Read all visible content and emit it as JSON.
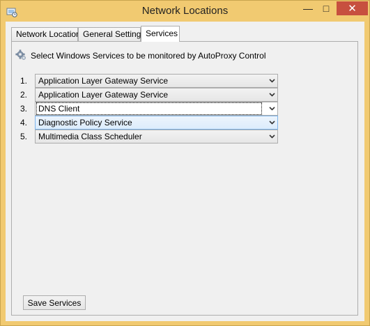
{
  "window": {
    "title": "Network Locations",
    "minimize_glyph": "—",
    "maximize_glyph": "□",
    "close_glyph": "✕"
  },
  "tabs": [
    {
      "label": "Network Location",
      "active": false
    },
    {
      "label": "General Settings",
      "active": false
    },
    {
      "label": "Services",
      "active": true
    }
  ],
  "services_tab": {
    "header": "Select Windows Services to be monitored by AutoProxy Control",
    "rows": [
      {
        "number": "1.",
        "value": "Application Layer Gateway Service"
      },
      {
        "number": "2.",
        "value": "Application Layer Gateway Service"
      },
      {
        "number": "3.",
        "value": "DNS Client"
      },
      {
        "number": "4.",
        "value": "Diagnostic Policy Service"
      },
      {
        "number": "5.",
        "value": "Multimedia Class Scheduler"
      }
    ],
    "save_label": "Save Services"
  },
  "colors": {
    "window_frame": "#f1ca71",
    "close_button": "#c7503f",
    "hover_combo": "#dcecfc"
  }
}
